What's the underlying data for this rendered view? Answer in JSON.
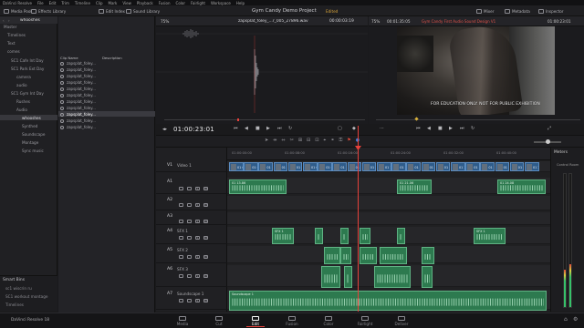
{
  "menubar": [
    "DaVinci Resolve",
    "File",
    "Edit",
    "Trim",
    "Timeline",
    "Clip",
    "Mark",
    "View",
    "Playback",
    "Fusion",
    "Color",
    "Fairlight",
    "Workspace",
    "Help"
  ],
  "toolbar": {
    "media_pool": "Media Pool",
    "effects_library": "Effects Library",
    "edit_index": "Edit Index",
    "sound_library": "Sound Library",
    "project_title": "Gym Candy Demo Project",
    "edited": "Edited",
    "mixer": "Mixer",
    "metadata": "Metadata",
    "inspector": "Inspector"
  },
  "bins": {
    "header": "whooshes",
    "items": [
      "Master",
      "Timelines",
      "Text",
      "comes",
      "SC1 Cafe Int Day",
      "SC1 Park Ext Day",
      "camera",
      "audio",
      "SC1 Gym Int Day",
      "Rushes",
      "Audio",
      "whooshes",
      "Synthed",
      "Soundscape",
      "Montage",
      "Sync music"
    ],
    "selected": "whooshes"
  },
  "smart_bins": {
    "title": "Smart Bins",
    "items": [
      "sc1 wiscrin ru",
      "SC1 workout montage",
      "Timelines"
    ]
  },
  "clip_list": {
    "col_name": "Clip Name",
    "col_desc": "Description",
    "clips": [
      "zapsplat_foley...",
      "zapsplat_foley...",
      "zapsplat_foley...",
      "zapsplat_foley...",
      "zapsplat_foley...",
      "zapsplat_foley...",
      "zapsplat_foley...",
      "zapsplat_foley...",
      "zapsplat_foley...",
      "zapsplat_foley...",
      "zapsplat_foley..."
    ],
    "selected_index": 8
  },
  "source_viewer": {
    "zoom": "75%",
    "clip_name": "zapsplat_foley_...r_005_27896.wav",
    "timecode": "00:00:03:19"
  },
  "timeline_viewer": {
    "zoom": "75%",
    "timecode_left": "00:01:35:05",
    "timeline_name": "Gym Candy First Audio Sound Design V1",
    "timecode_right": "01:00:23:01",
    "caption": "FOR EDUCATION ONLY. NOT FOR PUBLIC EXHIBITION"
  },
  "timeline": {
    "timecode": "01:00:23:01",
    "ruler_labels": [
      "01:00:00:00",
      "01:00:08:00",
      "01:00:16:00",
      "01:00:24:00",
      "01:00:32:00",
      "01:00:40:00"
    ]
  },
  "tracks": [
    {
      "id": "V1",
      "name": "Video 1"
    },
    {
      "id": "A1",
      "name": ""
    },
    {
      "id": "A2",
      "name": ""
    },
    {
      "id": "A3",
      "name": ""
    },
    {
      "id": "A4",
      "name": "SFX 1"
    },
    {
      "id": "A5",
      "name": "SFX 2"
    },
    {
      "id": "A6",
      "name": "SFX 3"
    },
    {
      "id": "A7",
      "name": "Soundscape 1"
    }
  ],
  "clips": {
    "v1": [
      "01 02...",
      "01 03...",
      "01 04...",
      "01 05...",
      "01 06...",
      "01 07...",
      "01 08...",
      "01 09...",
      "01 10...",
      "01 11...",
      "01 12...",
      "01 13...",
      "01 14...",
      "01 15...",
      "01 16...",
      "01 17...",
      "01 19...",
      "01 20...",
      "01 21...",
      "01 22...",
      "01 23..."
    ],
    "a1": [
      "01 13.86",
      "01 21.06",
      "01 24.08"
    ],
    "a4": [
      "SFX 1",
      "SFX 1"
    ],
    "a7": [
      "Soundscape 1"
    ]
  },
  "mixer": {
    "title": "Meters",
    "control_room": "Control Room"
  },
  "pages": [
    "Media",
    "Cut",
    "Edit",
    "Fusion",
    "Color",
    "Fairlight",
    "Deliver"
  ],
  "active_page": "Edit",
  "app_name": "DaVinci Resolve 18"
}
